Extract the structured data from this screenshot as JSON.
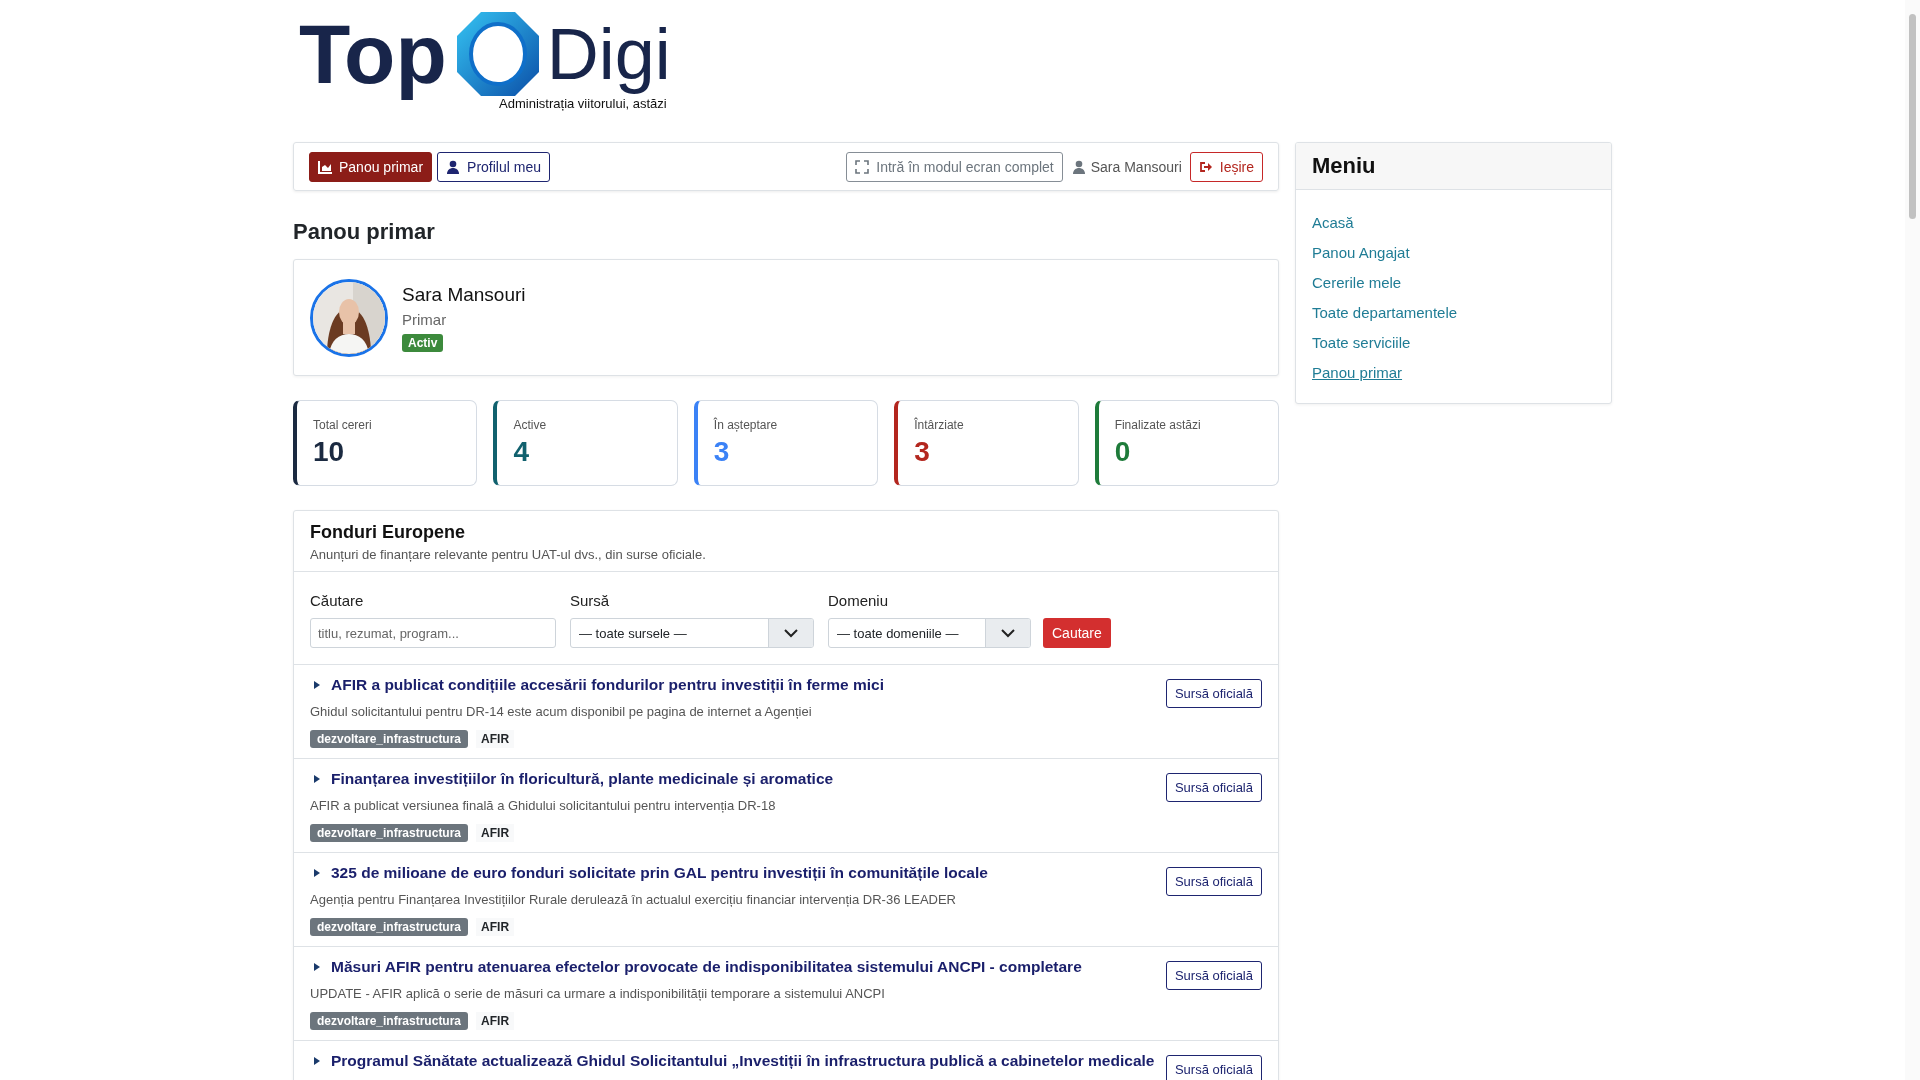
{
  "logo": {
    "word_1": "Top",
    "word_2": "Digi",
    "tagline": "Administrația viitorului, astăzi"
  },
  "toolbar": {
    "nav": [
      {
        "label": "Panou primar",
        "kind": "chart",
        "selected": true
      },
      {
        "label": "Profilul meu",
        "kind": "user",
        "selected": false
      }
    ],
    "fullscreen": "Intră în modul ecran complet",
    "user": "Sara Mansouri",
    "logout": "Ieșire"
  },
  "page_title": "Panou primar",
  "profile": {
    "name": "Sara Mansouri",
    "role": "Primar",
    "status": "Activ",
    "active": true
  },
  "stats": [
    {
      "label": "Total cereri",
      "value": "10",
      "color": "#1b2a41"
    },
    {
      "label": "Active",
      "value": "4",
      "color": "#11616e"
    },
    {
      "label": "În așteptare",
      "value": "3",
      "color": "#3b82f6"
    },
    {
      "label": "Întârziate",
      "value": "3",
      "color": "#b3261e"
    },
    {
      "label": "Finalizate astăzi",
      "value": "0",
      "color": "#1e7b3a"
    }
  ],
  "funds": {
    "title": "Fonduri Europene",
    "subtitle": "Anunțuri de finanțare relevante pentru UAT-ul dvs., din surse oficiale.",
    "filters": {
      "search_label": "Căutare",
      "search_placeholder": "titlu, rezumat, program...",
      "source_label": "Sursă",
      "source_value": "— toate sursele —",
      "domain_label": "Domeniu",
      "domain_value": "— toate domeniile —",
      "button": "Cautare"
    },
    "items": [
      {
        "title": "AFIR a publicat condițiile accesării fondurilor pentru investiții în ferme mici",
        "summary": "Ghidul solicitantului pentru DR-14 este acum disponibil pe pagina de internet a Agenției",
        "tag": "dezvoltare_infrastructura",
        "source": "AFIR",
        "button": "Sursă oficială"
      },
      {
        "title": "Finanțarea investițiilor în floricultură, plante medicinale și aromatice",
        "summary": "AFIR a publicat versiunea finală a Ghidului solicitantului pentru intervenția DR-18",
        "tag": "dezvoltare_infrastructura",
        "source": "AFIR",
        "button": "Sursă oficială"
      },
      {
        "title": "325 de milioane de euro fonduri solicitate prin GAL pentru investiții în comunitățile locale",
        "summary": "Agenția pentru Finanțarea Investițiilor Rurale derulează în actualul exercițiu financiar intervenția DR-36 LEADER",
        "tag": "dezvoltare_infrastructura",
        "source": "AFIR",
        "button": "Sursă oficială"
      },
      {
        "title": "Măsuri AFIR pentru atenuarea efectelor provocate de indisponibilitatea sistemului ANCPI - completare",
        "summary": "UPDATE - AFIR aplică o serie de măsuri ca urmare a indisponibilității temporare a sistemului ANCPI",
        "tag": "dezvoltare_infrastructura",
        "source": "AFIR",
        "button": "Sursă oficială"
      },
      {
        "title": "Programul Sănătate actualizează Ghidul Solicitantului „Investiții în infrastructura publică a cabinetelor medicale",
        "button": "Sursă oficială"
      }
    ]
  },
  "menu": {
    "title": "Meniu",
    "items": [
      {
        "label": "Acasă",
        "selected": false
      },
      {
        "label": "Panou Angajat",
        "selected": false
      },
      {
        "label": "Cererile mele",
        "selected": false
      },
      {
        "label": "Toate departamentele",
        "selected": false
      },
      {
        "label": "Toate serviciile",
        "selected": false
      },
      {
        "label": "Panou primar",
        "selected": true
      }
    ]
  }
}
